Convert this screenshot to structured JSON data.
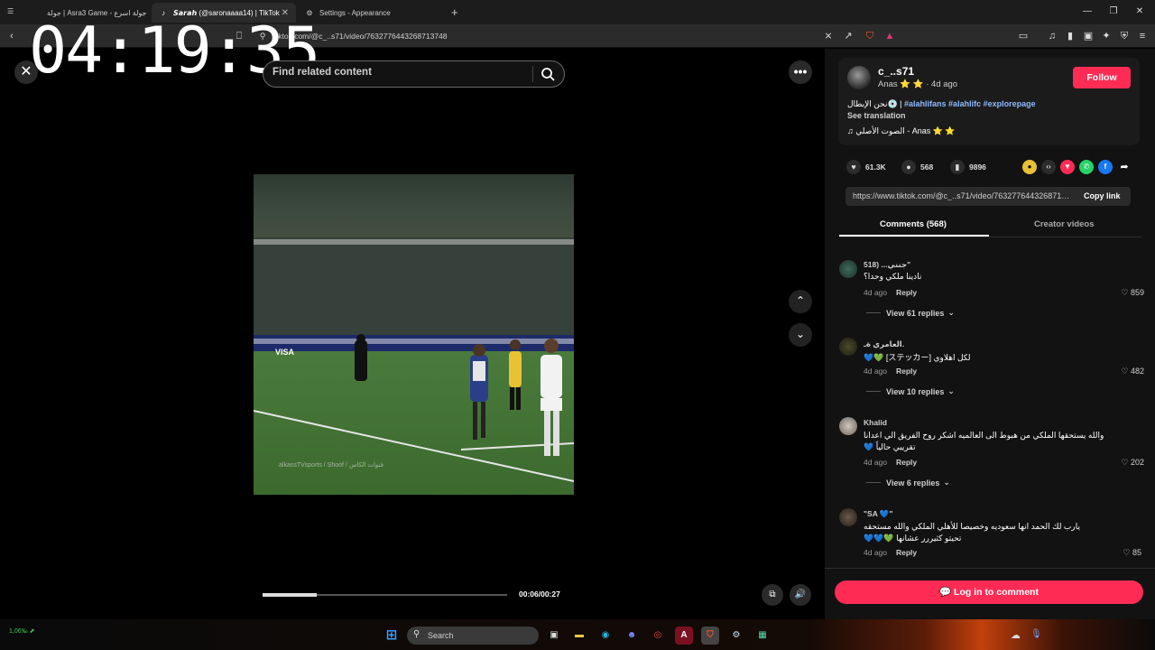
{
  "browser": {
    "tabs": [
      {
        "label": "جولة | Asra3 Game - جولة اسرع",
        "icon": "game-icon"
      },
      {
        "label": "𝙎𝙖𝙧𝙖𝙝 (@saronaaaa14) | TikTok",
        "icon": "tiktok-icon",
        "active": true
      },
      {
        "label": "Settings - Appearance",
        "icon": "gear-icon"
      }
    ],
    "new_tab": "+",
    "url": "tiktok.com/@c_..s71/video/7632776443268713748"
  },
  "clock_overlay": "04:19:35",
  "player": {
    "search_placeholder": "Find related content",
    "time": "00:06/00:27",
    "progress": 0.22,
    "watermark": "alkassTVsports / Shoof / قنوات الكاس"
  },
  "video_info": {
    "username": "c_..s71",
    "subtitle": "Anas ⭐ ⭐ · 4d ago",
    "follow": "Follow",
    "desc_ar": "نحن الإبطال💿 |",
    "hashtags": "#alahlifans #alahlifc #explorepage",
    "see_translation": "See translation",
    "music": "الصوت الأصلي - Anas ⭐ ⭐",
    "likes": "61.3K",
    "comments_count": "568",
    "saves": "9896",
    "link": "https://www.tiktok.com/@c_..s71/video/7632776443268713748",
    "copy_link": "Copy link",
    "tab_comments": "Comments (568)",
    "tab_creator": "Creator videos"
  },
  "comments": [
    {
      "name": "جنني... (518\"",
      "text": "نادينا ملكي وحدا؟",
      "date": "4d ago",
      "reply": "Reply",
      "likes": "859",
      "view": "View 61 replies"
    },
    {
      "name": "العامري ةـ.",
      "text": "لكل اهلاوي [ステッカー] 💚💙",
      "date": "4d ago",
      "reply": "Reply",
      "likes": "482",
      "view": "View 10 replies"
    },
    {
      "name": "Khalid",
      "text": "والله يستحقها الملكي من هبوط الى العالميه اشكر روح الفريق الي اعدانا تقريبي حالياً 💙",
      "date": "4d ago",
      "reply": "Reply",
      "likes": "202",
      "view": "View 6 replies"
    },
    {
      "name": "\"SA 💙\"",
      "text": "يارب لك الحمد انها سعوديه وخصيصا للأهلي الملكي والله مستحقه تحيتو كثيررر عشانها 💚💙💙",
      "date": "4d ago",
      "reply": "Reply",
      "likes": "85",
      "view": ""
    }
  ],
  "login_comment": "Log in to comment",
  "taskbar": {
    "search": "Search",
    "stock": "1,06‰ ⬈"
  },
  "colors": {
    "accent": "#fe2c55",
    "hashtag": "#8fb9ff",
    "panel": "#121212"
  }
}
